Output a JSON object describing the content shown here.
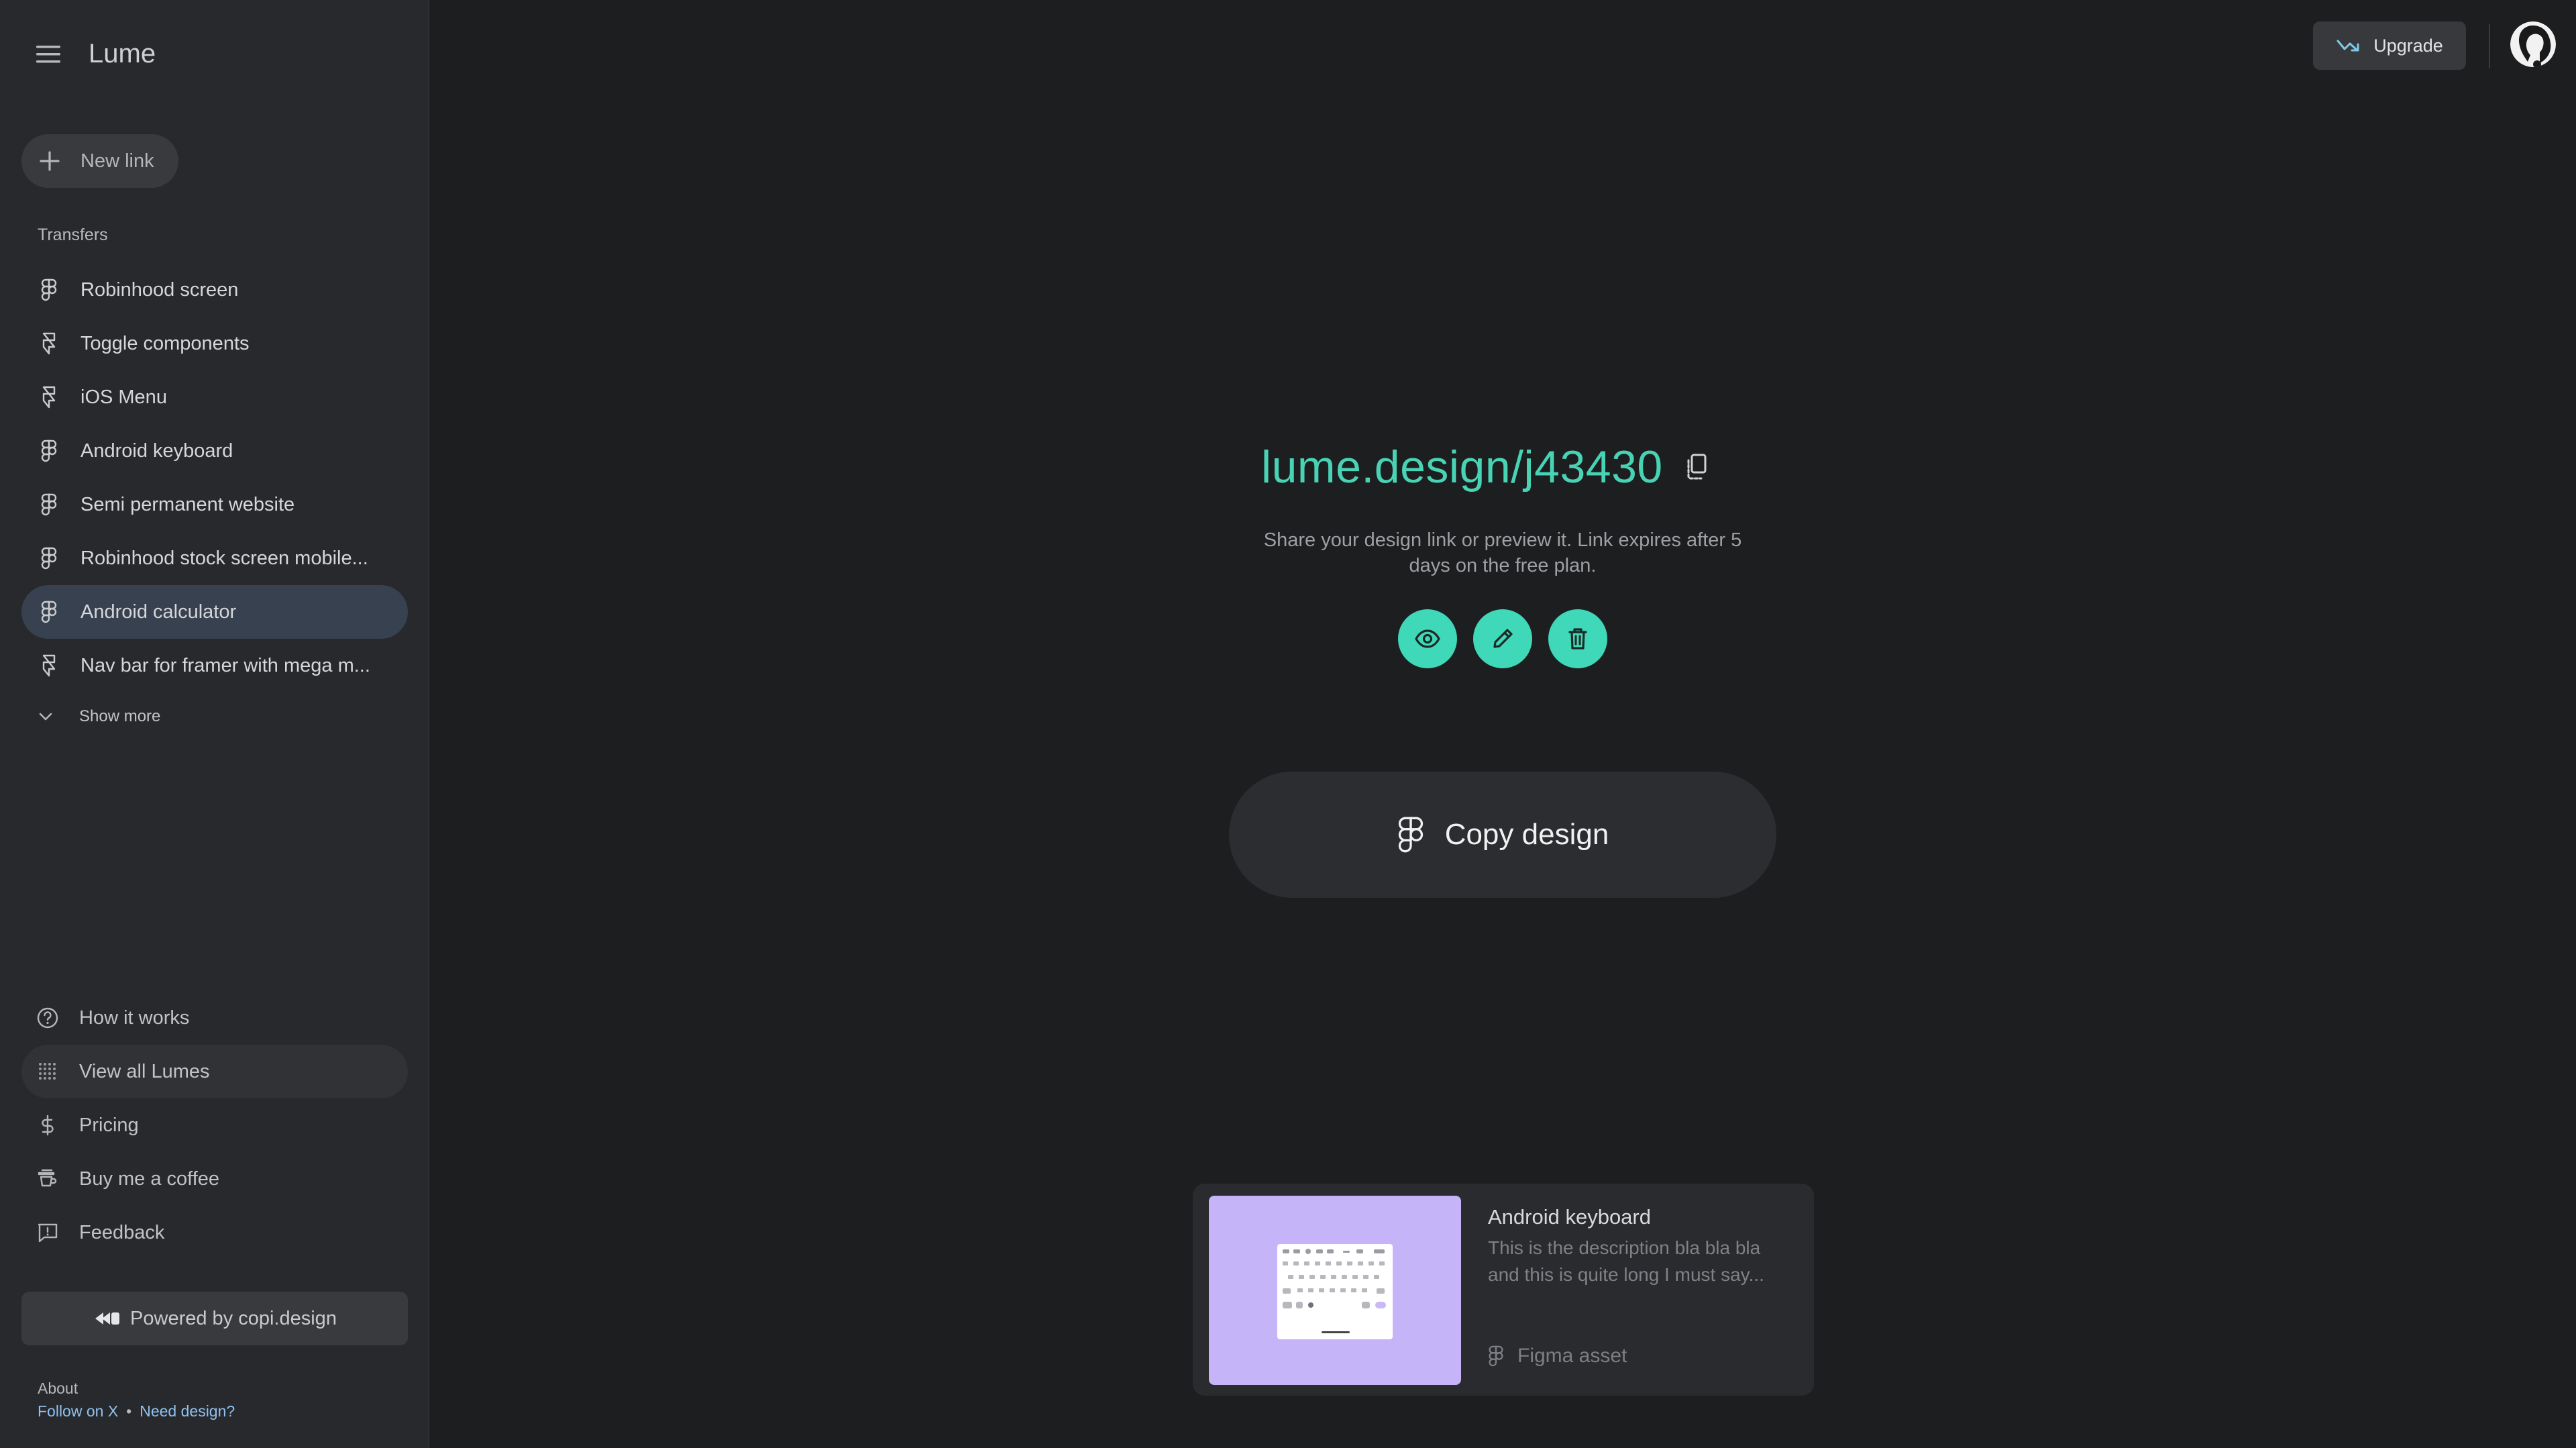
{
  "app": {
    "title": "Lume"
  },
  "sidebar": {
    "new_link_label": "New link",
    "section_label": "Transfers",
    "items": [
      {
        "label": "Robinhood screen",
        "active": false
      },
      {
        "label": "Toggle components",
        "active": false
      },
      {
        "label": "iOS Menu",
        "active": false
      },
      {
        "label": "Android keyboard",
        "active": false
      },
      {
        "label": "Semi permanent website",
        "active": false
      },
      {
        "label": "Robinhood stock screen mobile...",
        "active": false
      },
      {
        "label": "Android calculator",
        "active": true
      },
      {
        "label": "Nav bar for framer with mega m...",
        "active": false
      }
    ],
    "show_more_label": "Show more",
    "bottom_items": [
      {
        "label": "How it works",
        "icon": "help-circle-icon"
      },
      {
        "label": "View all Lumes",
        "icon": "grid-icon"
      },
      {
        "label": "Pricing",
        "icon": "dollar-icon"
      },
      {
        "label": "Buy me a coffee",
        "icon": "coffee-icon"
      },
      {
        "label": "Feedback",
        "icon": "feedback-icon"
      }
    ],
    "powered_label": "Powered by copi.design",
    "about_label": "About",
    "footer_links": {
      "follow": "Follow on X",
      "separator": "•",
      "need_design": "Need design?"
    }
  },
  "header": {
    "upgrade_label": "Upgrade"
  },
  "main": {
    "link": "lume.design/j43430",
    "description": "Share your design link or preview it. Link expires after 5 days on the free plan.",
    "copy_design_label": "Copy design"
  },
  "card": {
    "title": "Android keyboard",
    "description": "This is the description bla bla bla and this is quite long I must say...",
    "type": "Figma asset"
  },
  "colors": {
    "accent": "#3fd8b8",
    "link": "#49d3b5",
    "background": "#1d1e20",
    "sidebar": "#28292c",
    "thumbnail": "#c5b4f8",
    "footer_link": "#8fc1f0"
  }
}
